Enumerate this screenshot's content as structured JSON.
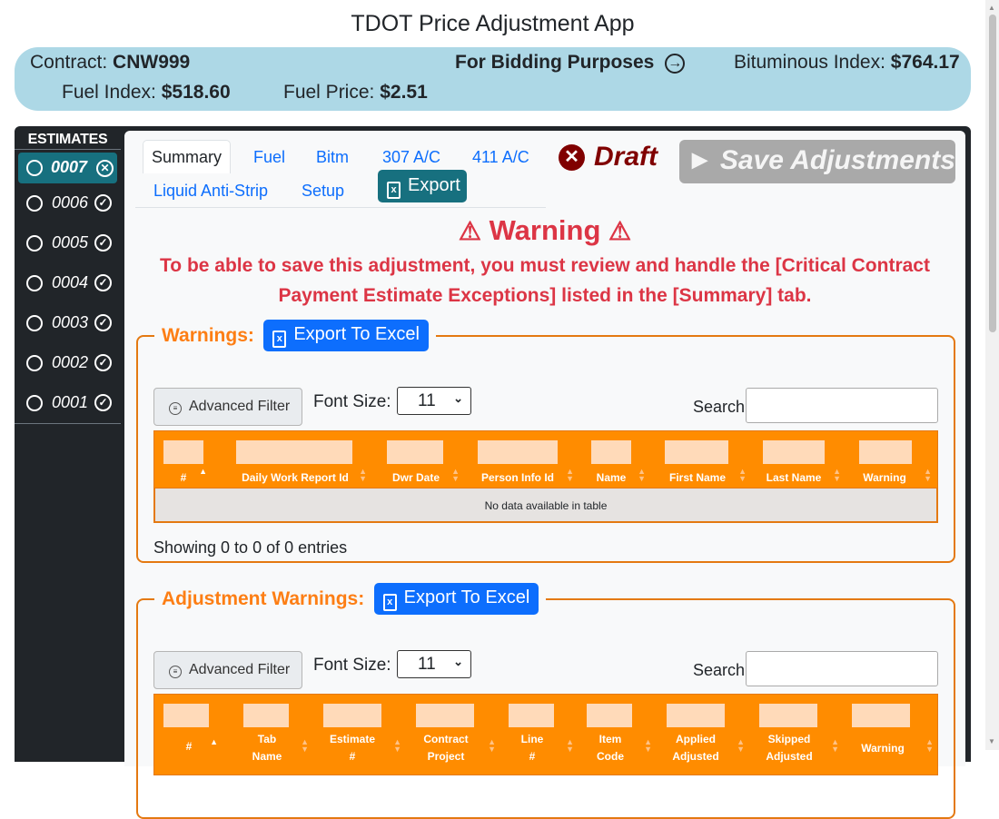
{
  "app": {
    "title": "TDOT Price Adjustment App"
  },
  "info": {
    "contract_label": "Contract:",
    "contract_value": "CNW999",
    "bidding_label": "For Bidding Purposes",
    "bituminous_label": "Bituminous Index:",
    "bituminous_value": "$764.17",
    "fuel_index_label": "Fuel Index:",
    "fuel_index_value": "$518.60",
    "fuel_price_label": "Fuel Price:",
    "fuel_price_value": "$2.51"
  },
  "sidebar": {
    "header": "ESTIMATES",
    "items": [
      {
        "label": "0007",
        "status": "rejected",
        "active": true
      },
      {
        "label": "0006",
        "status": "approved"
      },
      {
        "label": "0005",
        "status": "approved"
      },
      {
        "label": "0004",
        "status": "approved"
      },
      {
        "label": "0003",
        "status": "approved"
      },
      {
        "label": "0002",
        "status": "approved"
      },
      {
        "label": "0001",
        "status": "approved"
      }
    ]
  },
  "tabs": [
    "Summary",
    "Fuel",
    "Bitm",
    "307 A/C",
    "411 A/C",
    "Liquid Anti-Strip",
    "Setup"
  ],
  "export_label": "Export",
  "draft_label": "Draft",
  "save_label": "Save Adjustments",
  "warning": {
    "title": "Warning",
    "message": "To be able to save this adjustment, you must review and handle the [Critical Contract Payment Estimate Exceptions] listed in the [Summary] tab."
  },
  "warnings_section": {
    "legend": "Warnings:",
    "export_label": "Export To Excel",
    "filter_label": "Advanced Filter",
    "font_size_label": "Font Size:",
    "font_size_value": "11",
    "search_label": "Search:",
    "columns": [
      "#",
      "Daily Work Report Id",
      "Dwr Date",
      "Person Info Id",
      "Name",
      "First Name",
      "Last Name",
      "Warning"
    ],
    "empty_text": "No data available in table",
    "showing": "Showing 0 to 0 of 0 entries"
  },
  "adjustment_section": {
    "legend": "Adjustment Warnings:",
    "export_label": "Export To Excel",
    "filter_label": "Advanced Filter",
    "font_size_label": "Font Size:",
    "font_size_value": "11",
    "search_label": "Search:",
    "columns": [
      {
        "l1": "#",
        "l2": ""
      },
      {
        "l1": "Tab",
        "l2": "Name"
      },
      {
        "l1": "Estimate",
        "l2": "#"
      },
      {
        "l1": "Contract",
        "l2": "Project"
      },
      {
        "l1": "Line",
        "l2": "#"
      },
      {
        "l1": "Item",
        "l2": "Code"
      },
      {
        "l1": "Applied",
        "l2": "Adjusted"
      },
      {
        "l1": "Skipped",
        "l2": "Adjusted"
      },
      {
        "l1": "Warning",
        "l2": ""
      }
    ]
  },
  "colors": {
    "accent_teal": "#17707f",
    "orange": "#ff8c00",
    "danger": "#dc3545",
    "draft": "#800000",
    "info_bar": "#add8e6"
  }
}
